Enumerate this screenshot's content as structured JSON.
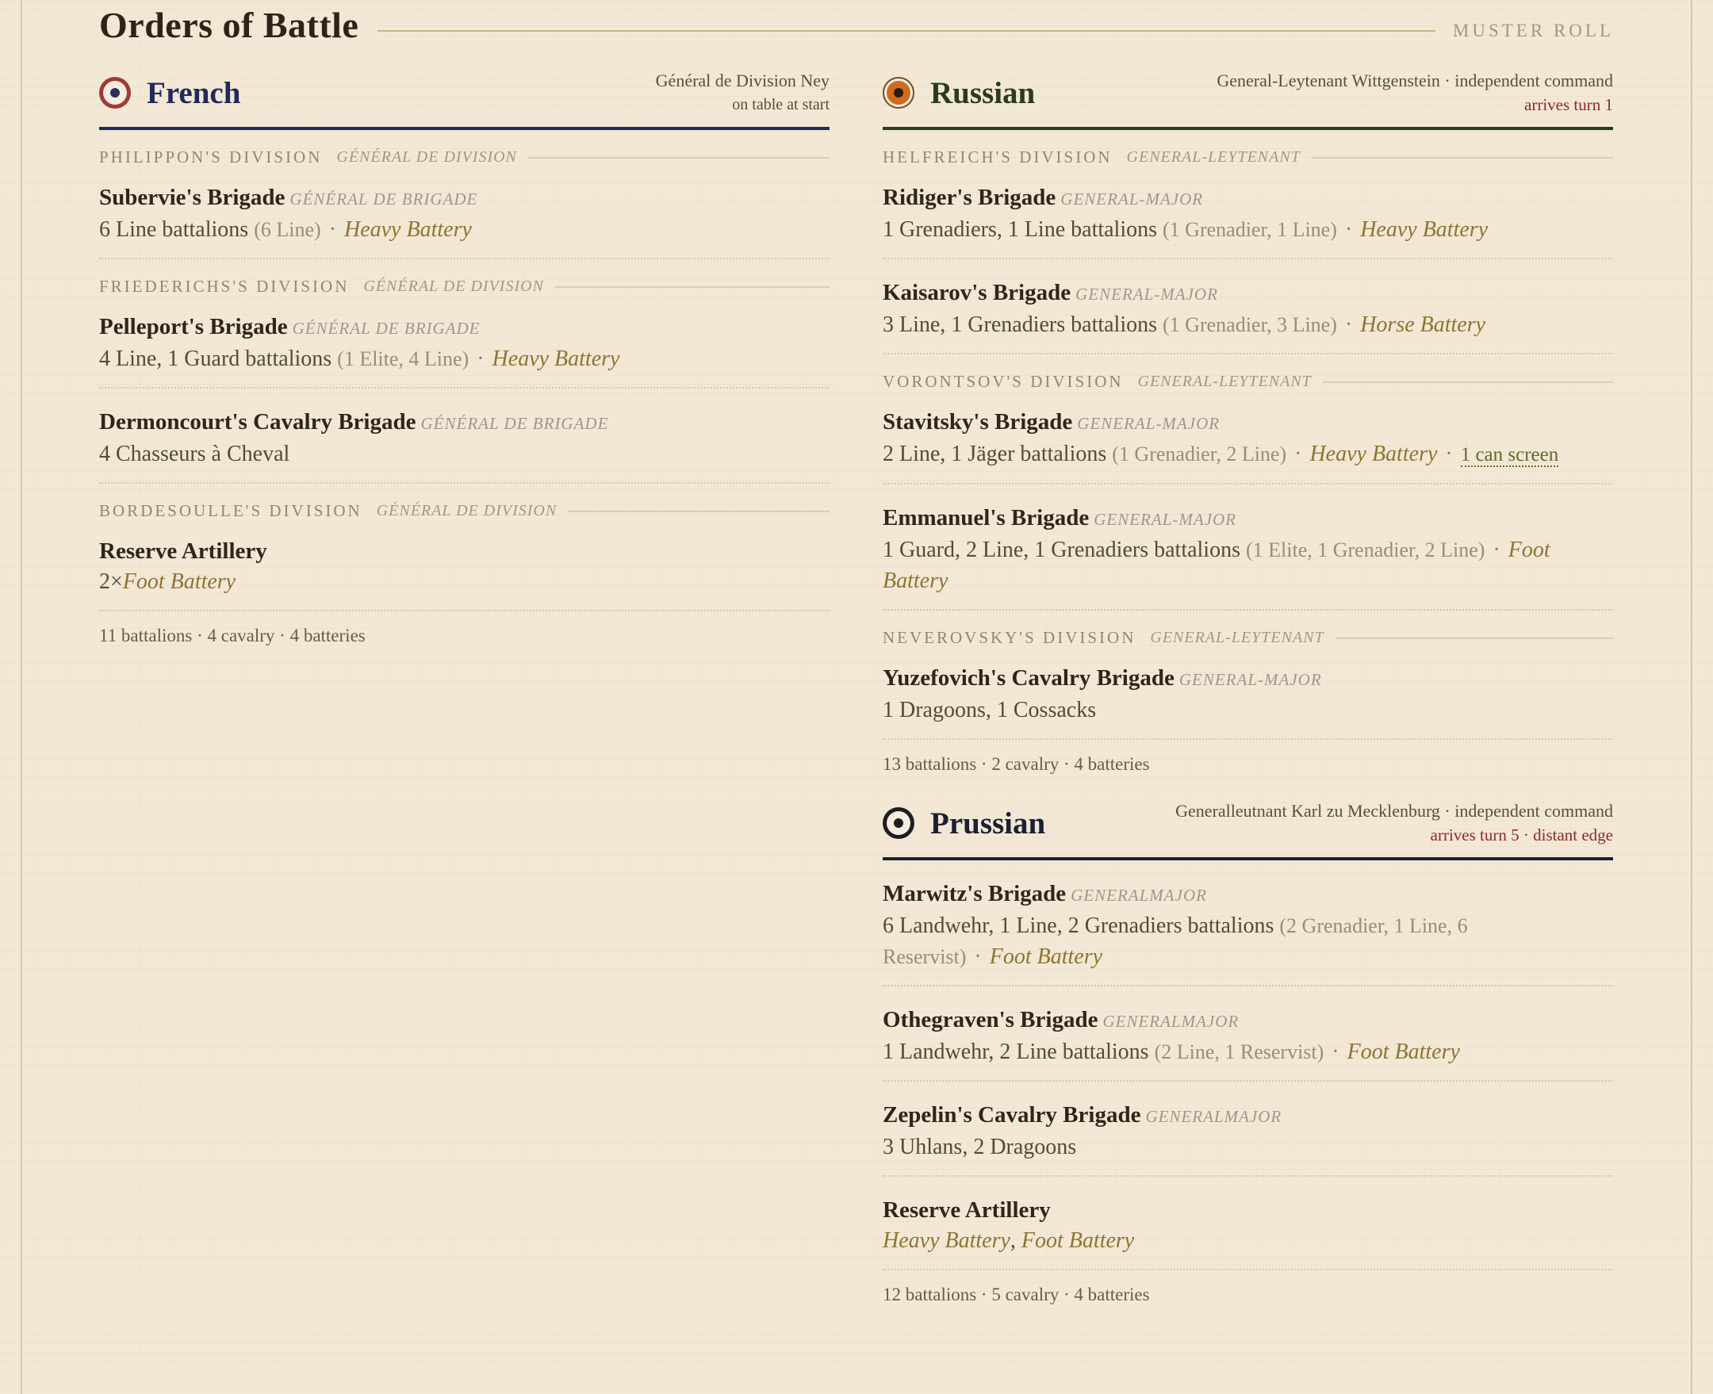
{
  "header": {
    "title": "Orders of Battle",
    "subtitle": "MUSTER ROLL"
  },
  "sep": "·",
  "french": {
    "name": "French",
    "commander": "Général de Division Ney",
    "status": "on table at start",
    "colors": {
      "primary": "#222a5b",
      "roundel_outer": "#a13a32",
      "roundel_inner": "#2a2f5e"
    },
    "divisions": [
      {
        "name": "PHILIPPON'S DIVISION",
        "rank": "GÉNÉRAL DE DIVISION",
        "units": [
          {
            "name": "Subervie's Brigade",
            "rank": "GÉNÉRAL DE BRIGADE",
            "troops": "6 Line battalions",
            "detail": "(6 Line)",
            "battery": "Heavy Battery"
          }
        ]
      },
      {
        "name": "FRIEDERICHS'S DIVISION",
        "rank": "GÉNÉRAL DE DIVISION",
        "units": [
          {
            "name": "Pelleport's Brigade",
            "rank": "GÉNÉRAL DE BRIGADE",
            "troops": "4 Line, 1 Guard battalions",
            "detail": "(1 Elite, 4 Line)",
            "battery": "Heavy Battery"
          },
          {
            "name": "Dermoncourt's Cavalry Brigade",
            "rank": "GÉNÉRAL DE BRIGADE",
            "troops": "4 Chasseurs à Cheval"
          }
        ]
      },
      {
        "name": "BORDESOULLE'S DIVISION",
        "rank": "GÉNÉRAL DE DIVISION",
        "units": [
          {
            "name": "Reserve Artillery",
            "count": "2×",
            "battery": "Foot Battery"
          }
        ]
      }
    ],
    "totals": "11 battalions · 4 cavalry · 4 batteries"
  },
  "russian": {
    "name": "Russian",
    "commander": "General-Leytenant Wittgenstein · independent command",
    "status": "arrives turn 1",
    "colors": {
      "primary": "#2c3a20",
      "roundel_outer": "#7a4a1e",
      "roundel_inner": "#d06a1e"
    },
    "divisions": [
      {
        "name": "HELFREICH'S DIVISION",
        "rank": "GENERAL-LEYTENANT",
        "units": [
          {
            "name": "Ridiger's Brigade",
            "rank": "GENERAL-MAJOR",
            "troops": "1 Grenadiers, 1 Line battalions",
            "detail": "(1 Grenadier, 1 Line)",
            "battery": "Heavy Battery"
          },
          {
            "name": "Kaisarov's Brigade",
            "rank": "GENERAL-MAJOR",
            "troops": "3 Line, 1 Grenadiers battalions",
            "detail": "(1 Grenadier, 3 Line)",
            "battery": "Horse Battery"
          }
        ]
      },
      {
        "name": "VORONTSOV'S DIVISION",
        "rank": "GENERAL-LEYTENANT",
        "units": [
          {
            "name": "Stavitsky's Brigade",
            "rank": "GENERAL-MAJOR",
            "troops": "2 Line, 1 Jäger battalions",
            "detail": "(1 Grenadier, 2 Line)",
            "battery": "Heavy Battery",
            "note": "1 can screen"
          },
          {
            "name": "Emmanuel's Brigade",
            "rank": "GENERAL-MAJOR",
            "troops": "1 Guard, 2 Line, 1 Grenadiers battalions",
            "detail": "(1 Elite, 1 Grenadier, 2 Line)",
            "battery": "Foot Battery"
          }
        ]
      },
      {
        "name": "NEVEROVSKY'S DIVISION",
        "rank": "GENERAL-LEYTENANT",
        "units": [
          {
            "name": "Yuzefovich's Cavalry Brigade",
            "rank": "GENERAL-MAJOR",
            "troops": "1 Dragoons, 1 Cossacks"
          }
        ]
      }
    ],
    "totals": "13 battalions · 2 cavalry · 4 batteries"
  },
  "prussian": {
    "name": "Prussian",
    "commander": "Generalleutnant Karl zu Mecklenburg · independent command",
    "status": "arrives turn 5 · distant edge",
    "colors": {
      "primary": "#1c2033",
      "roundel_outer": "#1e1e1e",
      "roundel_inner": "#1e1e1e"
    },
    "units": [
      {
        "name": "Marwitz's Brigade",
        "rank": "GENERALMAJOR",
        "troops": "6 Landwehr, 1 Line, 2 Grenadiers battalions",
        "detail": "(2 Grenadier, 1 Line, 6 Reservist)",
        "battery": "Foot Battery"
      },
      {
        "name": "Othegraven's Brigade",
        "rank": "GENERALMAJOR",
        "troops": "1 Landwehr, 2 Line battalions",
        "detail": "(2 Line, 1 Reservist)",
        "battery": "Foot Battery"
      },
      {
        "name": "Zepelin's Cavalry Brigade",
        "rank": "GENERALMAJOR",
        "troops": "3 Uhlans, 2 Dragoons"
      },
      {
        "name": "Reserve Artillery",
        "batteries": [
          "Heavy Battery",
          "Foot Battery"
        ],
        "joiner": ", "
      }
    ],
    "totals": "12 battalions · 5 cavalry · 4 batteries"
  }
}
